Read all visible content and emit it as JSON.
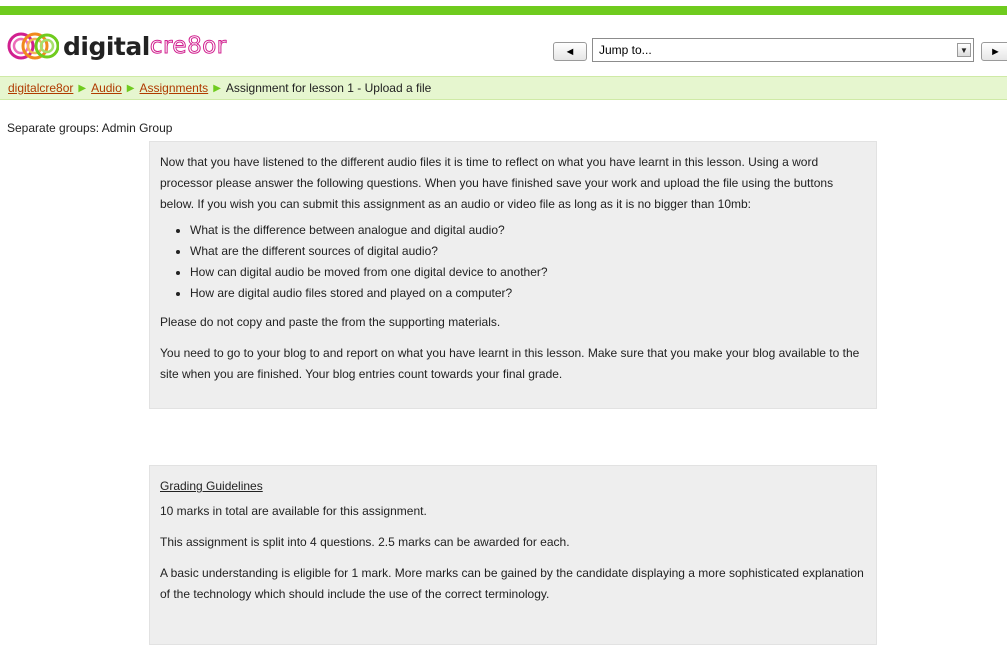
{
  "logo": {
    "word1": "digital",
    "word2": "cre8or",
    "alt": "digitalcre8or"
  },
  "nav": {
    "jump_value": "Jump to...",
    "prev_glyph": "◄",
    "next_glyph": "►"
  },
  "breadcrumb": {
    "items": [
      "digitalcre8or",
      "Audio",
      "Assignments"
    ],
    "current": "Assignment for lesson 1 - Upload a file",
    "separator": "▶"
  },
  "groups": {
    "label": "Separate groups: Admin Group"
  },
  "intro": {
    "paragraph": "Now that you have listened to the different audio files it is time to reflect on what you have learnt in this lesson. Using a word processor please answer the following questions. When you have finished save your work and upload the file using the buttons below. If you wish you can submit this assignment as an audio or video file as long as it is no bigger than 10mb:",
    "questions": [
      "What is the difference between analogue and digital audio?",
      "What are the different sources of digital audio?",
      "How can digital audio be moved from one digital device to another?",
      "How are digital audio files stored and played on a computer?"
    ],
    "note": "Please do not copy and paste the from the supporting materials.",
    "blog": "You need to go to your blog to and report on what you have learnt in this lesson. Make sure that you make your blog available to the site when you are finished. Your blog entries count towards your final grade."
  },
  "grading": {
    "title": "Grading Guidelines",
    "line1": "10 marks in total are available for this assignment.",
    "line2": "This assignment is split into 4 questions. 2.5 marks can be awarded for each.",
    "line3": "A basic understanding is eligible for 1 mark. More marks can be gained by the candidate displaying a more sophisticated explanation of the technology which should include the use of the correct terminology."
  },
  "colors": {
    "accent_green": "#6fcb1e",
    "link": "#b03a00",
    "crumb_bg": "#e6f6cf",
    "box_bg": "#eeeeee",
    "logo_pink": "#d1208f"
  }
}
